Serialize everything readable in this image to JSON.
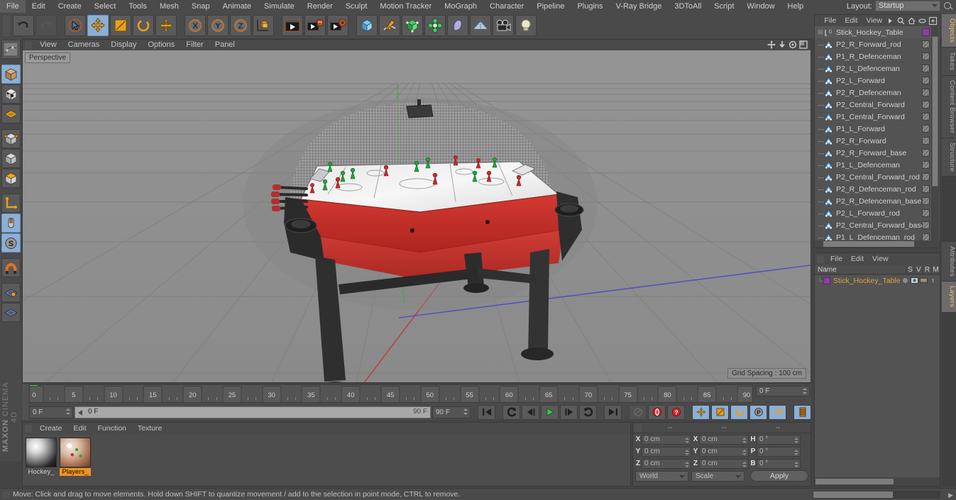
{
  "app": {
    "brand_top": "MAXON",
    "brand_bottom": "CINEMA 4D"
  },
  "menubar": {
    "items": [
      "File",
      "Edit",
      "Create",
      "Select",
      "Tools",
      "Mesh",
      "Snap",
      "Animate",
      "Simulate",
      "Render",
      "Sculpt",
      "Motion Tracker",
      "MoGraph",
      "Character",
      "Pipeline",
      "Plugins",
      "V-Ray Bridge",
      "3DToAll",
      "Script",
      "Window",
      "Help"
    ],
    "layout_label": "Layout:",
    "layout_value": "Startup"
  },
  "viewport": {
    "menus": [
      "View",
      "Cameras",
      "Display",
      "Options",
      "Filter",
      "Panel"
    ],
    "camera_label": "Perspective",
    "grid_spacing": "Grid Spacing : 100 cm"
  },
  "object_manager": {
    "menus": [
      "File",
      "Edit",
      "View"
    ],
    "root": {
      "label": "Stick_Hockey_Table",
      "level_badge": "0"
    },
    "items": [
      "P2_R_Forward_rod",
      "P1_R_Defenceman",
      "P2_L_Defenceman",
      "P2_L_Forward",
      "P2_R_Defenceman",
      "P2_Central_Forward",
      "P1_Central_Forward",
      "P1_L_Forward",
      "P2_R_Forward",
      "P2_R_Forward_base",
      "P1_L_Defenceman",
      "P2_Central_Forward_rod",
      "P2_R_Defenceman_rod",
      "P2_R_Defenceman_base",
      "P2_L_Forward_rod",
      "P2_Central_Forward_base",
      "P1_L_Defenceman_rod"
    ]
  },
  "layer_manager": {
    "menus": [
      "File",
      "Edit",
      "View"
    ],
    "columns": [
      "Name",
      "S",
      "V",
      "R",
      "M"
    ],
    "rows": [
      {
        "name": "Stick_Hockey_Table"
      }
    ]
  },
  "vertical_tabs": {
    "right": [
      "Objects",
      "Takes",
      "Content Browser",
      "Structure"
    ],
    "right2": [
      "Attributes",
      "Layers"
    ]
  },
  "timeline": {
    "ticks": [
      0,
      5,
      10,
      15,
      20,
      25,
      30,
      35,
      40,
      45,
      50,
      55,
      60,
      65,
      70,
      75,
      80,
      85,
      90
    ],
    "current_frame_field": "0 F",
    "end_frame_field": "0 F",
    "start_field": "0 F",
    "track_start_label": "0 F",
    "track_end_label": "90 F",
    "preview_end_field": "90 F"
  },
  "material_manager": {
    "menus": [
      "Create",
      "Edit",
      "Function",
      "Texture"
    ],
    "materials": [
      {
        "name": "Hockey_",
        "selected": false
      },
      {
        "name": "Players_",
        "selected": true
      }
    ]
  },
  "coordinates": {
    "headers": [
      "--",
      "--",
      "--"
    ],
    "position": {
      "x": "0 cm",
      "y": "0 cm",
      "z": "0 cm"
    },
    "size": {
      "x": "0 cm",
      "y": "0 cm",
      "z": "0 cm"
    },
    "rotation": {
      "h": "0 °",
      "p": "0 °",
      "b": "0 °"
    },
    "axis_labels": {
      "x": "X",
      "y": "Y",
      "z": "Z",
      "h": "H",
      "p": "P",
      "b": "B"
    },
    "system": "World",
    "mode": "Scale",
    "apply_label": "Apply"
  },
  "status_bar": {
    "message": "Move: Click and drag to move elements. Hold down SHIFT to quantize movement / add to the selection in point mode, CTRL to remove."
  },
  "colors": {
    "accent_orange": "#f0941e",
    "table_red": "#c42a26",
    "active_blue": "#8ab0d8",
    "playhead_green": "#4cd264",
    "layer_purple": "#8b3fa0"
  }
}
